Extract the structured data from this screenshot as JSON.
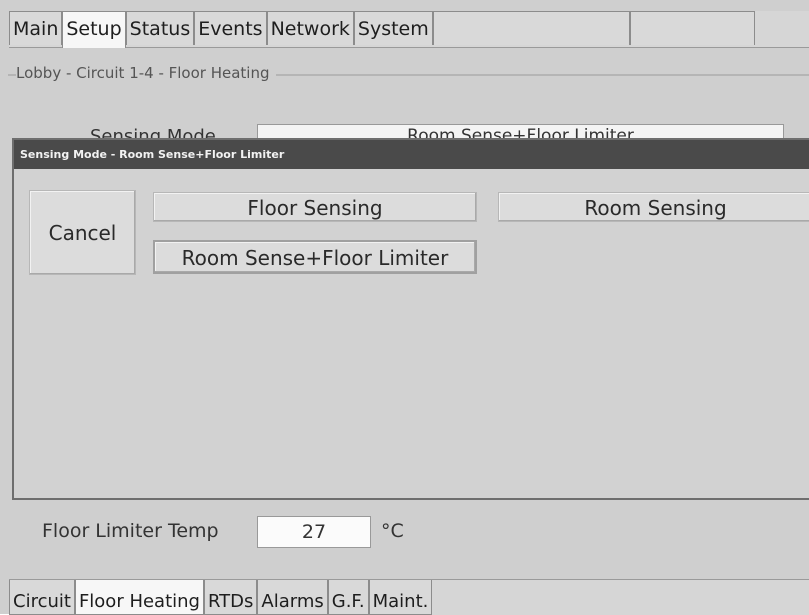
{
  "top_tabs": [
    "Main",
    "Setup",
    "Status",
    "Events",
    "Network",
    "System"
  ],
  "active_top_tab": "Setup",
  "group": {
    "title": "Lobby - Circuit 1-4 - Floor Heating"
  },
  "sensing_mode": {
    "label": "Sensing Mode",
    "value": "Room Sense+Floor Limiter"
  },
  "dialog": {
    "title": "Sensing Mode - Room Sense+Floor Limiter",
    "cancel_label": "Cancel",
    "options": [
      "Floor Sensing",
      "Room Sensing",
      "Room Sense+Floor Limiter"
    ]
  },
  "floor_limiter": {
    "label": "Floor Limiter Temp",
    "value": "27",
    "unit": "°C"
  },
  "bottom_tabs": [
    "Circuit",
    "Floor Heating",
    "RTDs",
    "Alarms",
    "G.F.",
    "Maint."
  ],
  "active_bottom_tab": "Floor Heating"
}
